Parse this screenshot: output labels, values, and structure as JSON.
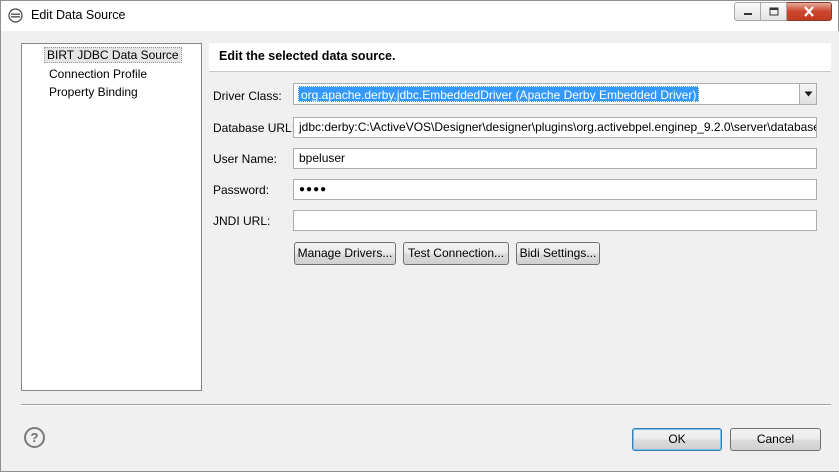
{
  "window": {
    "title": "Edit Data Source"
  },
  "nav": {
    "items": [
      {
        "label": "BIRT JDBC Data Source",
        "selected": true
      },
      {
        "label": "Connection Profile",
        "selected": false
      },
      {
        "label": "Property Binding",
        "selected": false
      }
    ]
  },
  "page": {
    "title": "Edit the selected data source."
  },
  "form": {
    "driver_class_label": "Driver Class:",
    "driver_class_value": "org.apache.derby.jdbc.EmbeddedDriver (Apache Derby Embedded Driver)",
    "database_url_label": "Database URL:",
    "database_url_value": "jdbc:derby:C:\\ActiveVOS\\Designer\\designer\\plugins\\org.activebpel.enginep_9.2.0\\server\\database",
    "user_name_label": "User Name:",
    "user_name_value": "bpeluser",
    "password_label": "Password:",
    "password_value": "●●●●",
    "jndi_url_label": "JNDI URL:",
    "jndi_url_value": ""
  },
  "buttons": {
    "manage_drivers": "Manage Drivers...",
    "test_connection": "Test Connection...",
    "bidi_settings": "Bidi Settings...",
    "ok": "OK",
    "cancel": "Cancel"
  },
  "help": {
    "glyph": "?"
  },
  "icons": {
    "app": "eclipse-icon",
    "minimize": "minimize-icon",
    "maximize": "maximize-icon",
    "close": "close-icon",
    "dropdown": "chevron-down-icon",
    "help": "help-icon"
  },
  "colors": {
    "selection": "#3399ff",
    "close_button": "#c9462c",
    "dialog_bg": "#f0f0f0"
  }
}
